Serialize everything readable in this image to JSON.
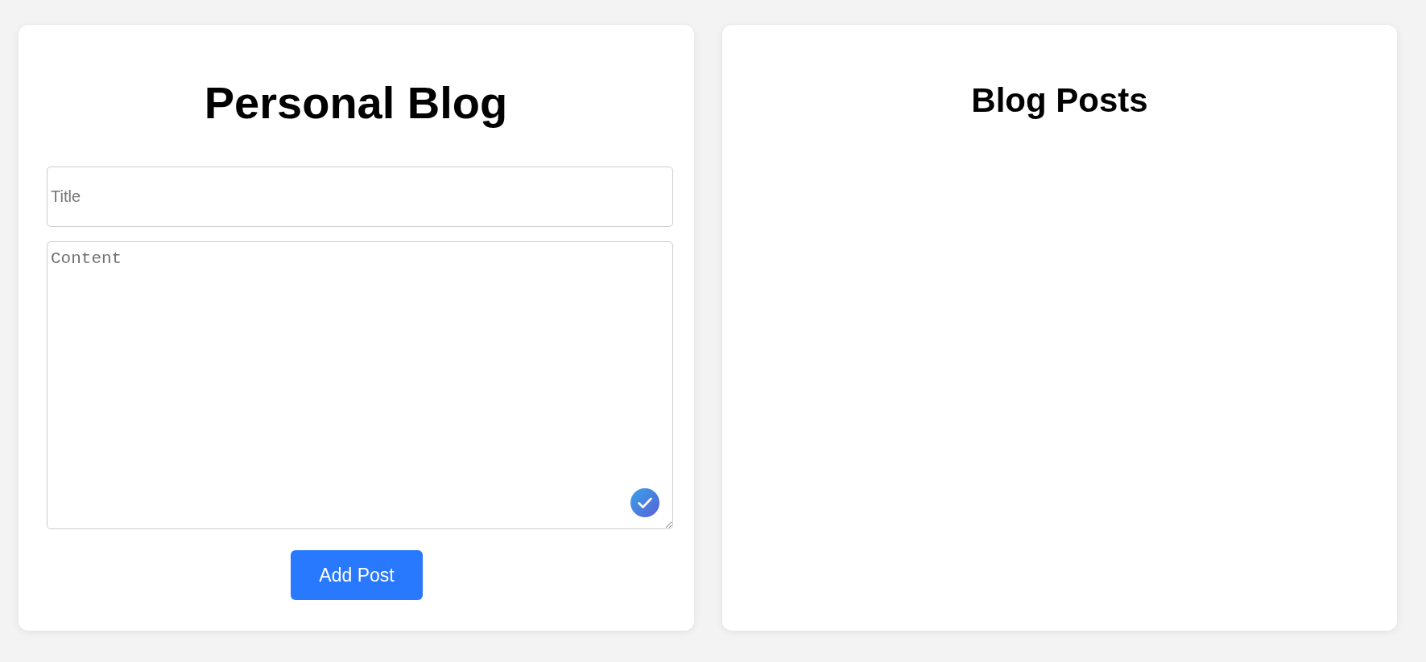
{
  "form": {
    "title": "Personal Blog",
    "title_field": {
      "placeholder": "Title"
    },
    "content_field": {
      "placeholder": "Content"
    },
    "submit_button": "Add Post"
  },
  "posts_panel": {
    "title": "Blog Posts"
  }
}
